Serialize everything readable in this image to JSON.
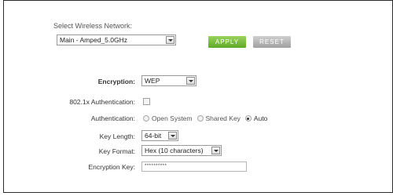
{
  "network": {
    "label": "Select Wireless Network:",
    "selected": "Main - Amped_5.0GHz"
  },
  "buttons": {
    "apply": "APPLY",
    "reset": "RESET"
  },
  "form": {
    "encryption_label": "Encryption:",
    "encryption_value": "WEP",
    "auth8021x_label": "802.1x Authentication:",
    "auth8021x_checked": false,
    "authentication_label": "Authentication:",
    "auth_options": [
      "Open System",
      "Shared Key",
      "Auto"
    ],
    "auth_selected": "Auto",
    "key_length_label": "Key Length:",
    "key_length_value": "64-bit",
    "key_format_label": "Key Format:",
    "key_format_value": "Hex (10 characters)",
    "encryption_key_label": "Encryption Key:",
    "encryption_key_value": "**********"
  },
  "colors": {
    "apply": "#6fb43a",
    "reset": "#b3b3b3",
    "border": "#2b2b2b"
  }
}
